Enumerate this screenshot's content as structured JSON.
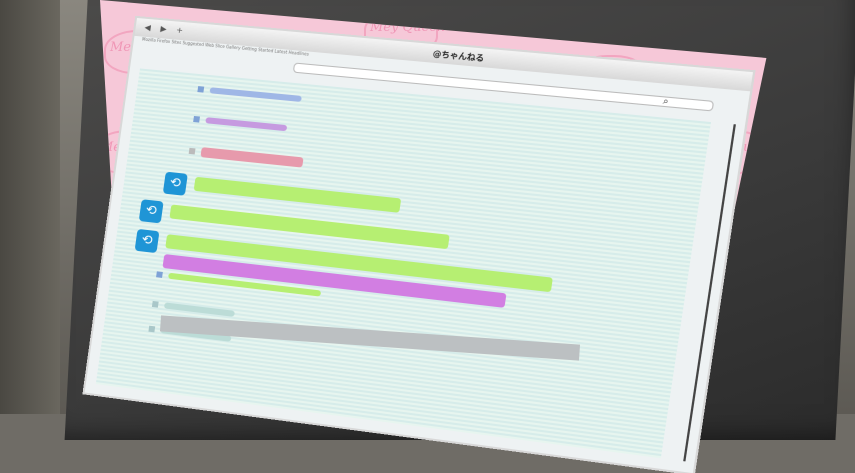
{
  "browser": {
    "page_title": "@ちゃんねる",
    "nav": {
      "back": "◀",
      "forward": "▶",
      "add": "+"
    },
    "bookmarks": "Mozilla Firefox  Sites  Suggested  Web Slice Gallery  Getting Started  Latest Headlines",
    "search_icon": "⌕"
  },
  "background": {
    "watermark": "Mey Queen"
  },
  "threads": [
    {
      "color": "#7fa2d6"
    },
    {
      "color": "#c69ae0"
    },
    {
      "color": "#e79aac"
    }
  ],
  "posts": [
    {
      "color": "green"
    },
    {
      "color": "green"
    },
    {
      "color": "green"
    },
    {
      "color": "purple"
    }
  ],
  "reply_icon": "⟲",
  "colors": {
    "screen_bg": "#f6c8d8",
    "watermark": "#ef8fb1",
    "reply_icon": "#1f95d6",
    "green_bar": "#b6ef72",
    "purple_bar": "#d27ee2"
  }
}
